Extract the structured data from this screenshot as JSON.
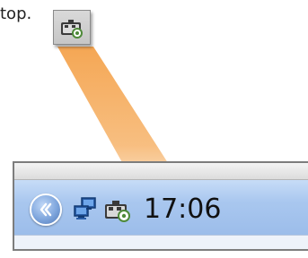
{
  "caption": {
    "text": "top."
  },
  "callout": {
    "icon": "camera-tray-icon"
  },
  "taskbar": {
    "show_hidden_icon": "chevron-left-icon",
    "network_icon": "network-computers-icon",
    "camera_icon": "camera-tray-icon",
    "clock": "17:06"
  },
  "colors": {
    "beam": "#f7a74c",
    "tray_blue": "#a9c7ef",
    "chevron_blue": "#6f96d2"
  }
}
